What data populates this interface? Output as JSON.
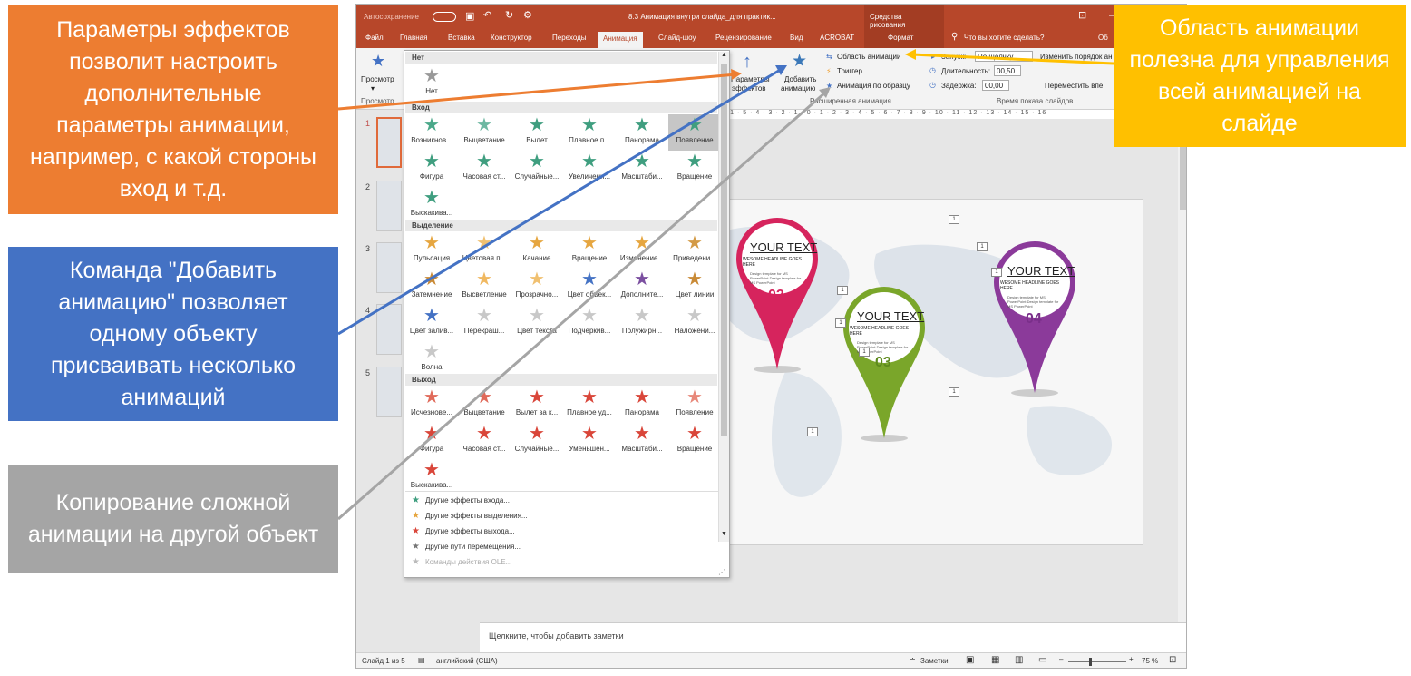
{
  "window": {
    "autosave": "Автосохранение",
    "title": "8.3 Анимация внутри слайда_для практик...",
    "drawing_tools": "Средства рисования",
    "tell_me": "Что вы хотите сделать?",
    "share": "Об"
  },
  "tabs": [
    "Файл",
    "Главная",
    "Вставка",
    "Конструктор",
    "Переходы",
    "Анимация",
    "Слайд-шоу",
    "Рецензирование",
    "Вид",
    "ACROBAT",
    "Формат"
  ],
  "ribbon": {
    "preview": "Просмотр",
    "preview_group": "Просмотр",
    "effect_options_1": "Параметры",
    "effect_options_2": "эффектов",
    "add_animation_1": "Добавить",
    "add_animation_2": "анимацию",
    "animation_pane": "Область анимации",
    "trigger": "Триггер",
    "animation_painter": "Анимация по образцу",
    "advanced_group": "Расширенная анимация",
    "start_label": "Запуск:",
    "start_value": "По щелчку",
    "duration_label": "Длительность:",
    "duration_value": "00,50",
    "delay_label": "Задержка:",
    "delay_value": "00,00",
    "reorder": "Изменить порядок ан",
    "move_earlier": "Переместить впе",
    "timing_group": "Время показа слайдов"
  },
  "ruler": "5 · 1 · 5 · 4 · 3 · 2 · 1 · 0 · 1 · 2 · 3 · 4 · 5 · 6 · 7 · 8 · 9 · 10 · 11 · 12 · 13 · 14 · 15 · 16",
  "thumbnails": [
    "1",
    "2",
    "3",
    "4",
    "5"
  ],
  "gallery": {
    "none_header": "Нет",
    "none_item": "Нет",
    "entrance_header": "Вход",
    "entrance": [
      {
        "label": "Возникнов...",
        "color": "#4aa889"
      },
      {
        "label": "Выцветание",
        "color": "#6db8a2"
      },
      {
        "label": "Вылет",
        "color": "#3f9e7f"
      },
      {
        "label": "Плавное п...",
        "color": "#3f9e7f"
      },
      {
        "label": "Панорама",
        "color": "#3f9e7f"
      },
      {
        "label": "Появление",
        "color": "#3f9e7f"
      },
      {
        "label": "Фигура",
        "color": "#3f9e7f"
      },
      {
        "label": "Часовая ст...",
        "color": "#3f9e7f"
      },
      {
        "label": "Случайные...",
        "color": "#3f9e7f"
      },
      {
        "label": "Увеличени...",
        "color": "#3f9e7f"
      },
      {
        "label": "Масштаби...",
        "color": "#3f9e7f"
      },
      {
        "label": "Вращение",
        "color": "#3f9e7f"
      },
      {
        "label": "Выскакива...",
        "color": "#3f9e7f"
      }
    ],
    "emphasis_header": "Выделение",
    "emphasis": [
      {
        "label": "Пульсация",
        "color": "#e6a640"
      },
      {
        "label": "Цветовая п...",
        "color": "#f0c070"
      },
      {
        "label": "Качание",
        "color": "#e6a640"
      },
      {
        "label": "Вращение",
        "color": "#e6a640"
      },
      {
        "label": "Изменение...",
        "color": "#e6a640"
      },
      {
        "label": "Приведени...",
        "color": "#d39a46"
      },
      {
        "label": "Затемнение",
        "color": "#c98a36"
      },
      {
        "label": "Высветление",
        "color": "#f0b860"
      },
      {
        "label": "Прозрачно...",
        "color": "#f0c070"
      },
      {
        "label": "Цвет объек...",
        "color": "#4472c4"
      },
      {
        "label": "Дополните...",
        "color": "#7b4fa0"
      },
      {
        "label": "Цвет линии",
        "color": "#c98a36"
      },
      {
        "label": "Цвет залив...",
        "color": "#4472c4"
      },
      {
        "label": "Перекраш...",
        "color": "#c8c8c8"
      },
      {
        "label": "Цвет текста",
        "color": "#c8c8c8"
      },
      {
        "label": "Подчеркив...",
        "color": "#c8c8c8"
      },
      {
        "label": "Полужирн...",
        "color": "#c8c8c8"
      },
      {
        "label": "Наложени...",
        "color": "#c8c8c8"
      },
      {
        "label": "Волна",
        "color": "#c8c8c8"
      }
    ],
    "exit_header": "Выход",
    "exit": [
      {
        "label": "Исчезнове...",
        "color": "#e06a5a"
      },
      {
        "label": "Выцветание",
        "color": "#e06a5a"
      },
      {
        "label": "Вылет за к...",
        "color": "#d9463a"
      },
      {
        "label": "Плавное уд...",
        "color": "#d9463a"
      },
      {
        "label": "Панорама",
        "color": "#d9463a"
      },
      {
        "label": "Появление",
        "color": "#e8887a"
      },
      {
        "label": "Фигура",
        "color": "#d9463a"
      },
      {
        "label": "Часовая ст...",
        "color": "#d9463a"
      },
      {
        "label": "Случайные...",
        "color": "#d9463a"
      },
      {
        "label": "Уменьшен...",
        "color": "#d9463a"
      },
      {
        "label": "Масштаби...",
        "color": "#d9463a"
      },
      {
        "label": "Вращение",
        "color": "#d9463a"
      },
      {
        "label": "Выскакива...",
        "color": "#d9463a"
      }
    ],
    "more": [
      {
        "label": "Другие эффекты входа...",
        "color": "#3f9e7f"
      },
      {
        "label": "Другие эффекты выделения...",
        "color": "#e6a640"
      },
      {
        "label": "Другие эффекты выхода...",
        "color": "#d9463a"
      },
      {
        "label": "Другие пути перемещения...",
        "color": "#777777"
      },
      {
        "label": "Команды действия OLE...",
        "color": "#bbbbbb"
      }
    ]
  },
  "slide": {
    "pins": [
      {
        "title": "YOUR TEXT",
        "headline": "WESOME HEADLINE GOES HERE",
        "body": "Design template for MS PowerPoint Design template for MS PowerPoint",
        "num": "02",
        "color": "#d6245d"
      },
      {
        "title": "YOUR TEXT",
        "headline": "WESOME HEADLINE GOES HERE",
        "body": "Design template for MS PowerPoint Design template for MS PowerPoint",
        "num": "03",
        "color": "#7aa62a"
      },
      {
        "title": "YOUR TEXT",
        "headline": "WESOME HEADLINE GOES HERE",
        "body": "Design template for MS PowerPoint Design template for MS PowerPoint",
        "num": "04",
        "color": "#8b3a9a"
      }
    ],
    "seq_tag": "1"
  },
  "notes": "Щелкните, чтобы добавить заметки",
  "status": {
    "slide_of": "Слайд 1 из 5",
    "language": "английский (США)",
    "notes_btn": "Заметки",
    "zoom": "75 %"
  },
  "callouts": {
    "effect_options": "Параметры эффектов позволит настроить дополнительные параметры анимации, например, с какой стороны вход и т.д.",
    "add_animation": "Команда \"Добавить анимацию\" позволяет одному объекту присваивать несколько анимаций",
    "animation_painter": "Копирование сложной анимации на другой объект",
    "animation_pane": "Область анимации полезна для управления всей анимацией на слайде"
  },
  "colors": {
    "office_red": "#b7472a",
    "orange": "#ed7d31",
    "blue": "#4472c4",
    "gray": "#a5a5a5",
    "yellow": "#ffc000"
  }
}
